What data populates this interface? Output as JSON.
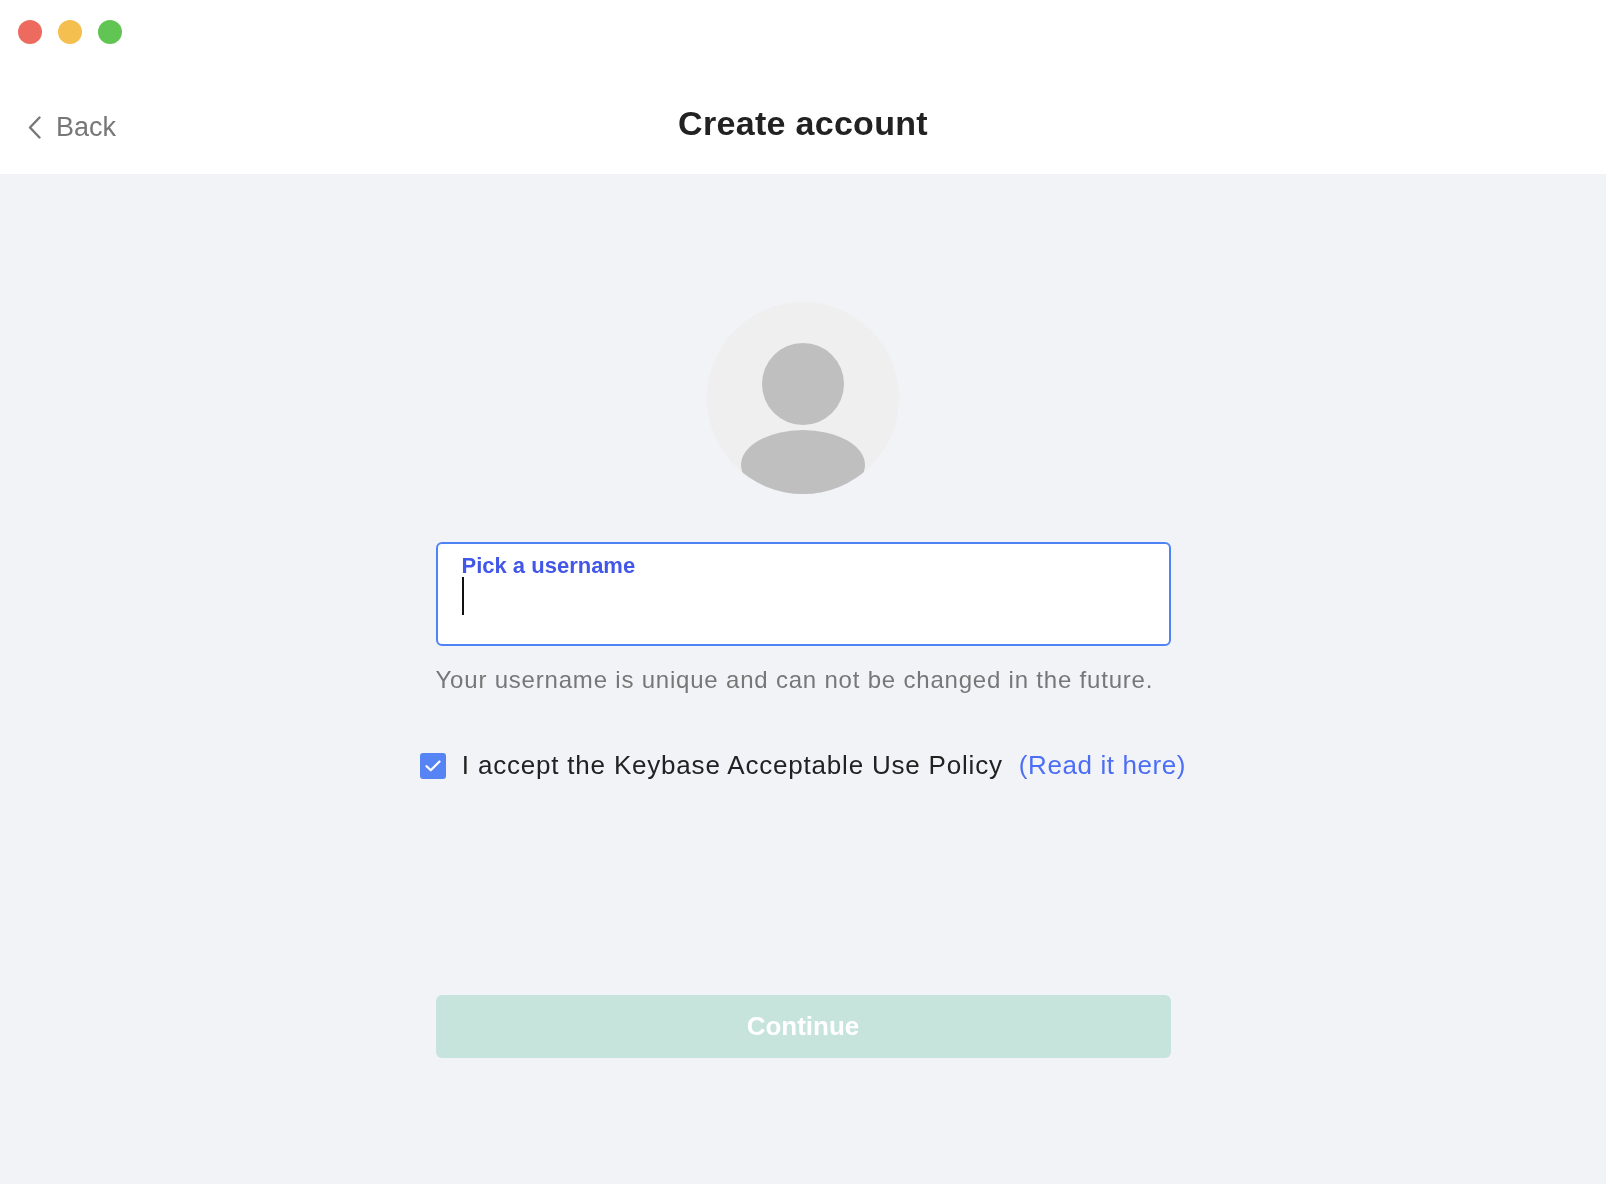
{
  "window": {
    "controls": [
      {
        "color": "#ed6a5e"
      },
      {
        "color": "#f5bf4f"
      },
      {
        "color": "#61c554"
      }
    ]
  },
  "header": {
    "back": {
      "label": "Back"
    },
    "title": "Create account"
  },
  "form": {
    "username": {
      "label": "Pick a username",
      "focused": true
    },
    "hint": "Your username is unique and can not be changed in the future.",
    "policy": {
      "checked": true,
      "text": "I accept the Keybase Acceptable Use Policy",
      "link": "(Read it here)"
    },
    "continue": {
      "label": "Continue",
      "disabled": true
    }
  }
}
